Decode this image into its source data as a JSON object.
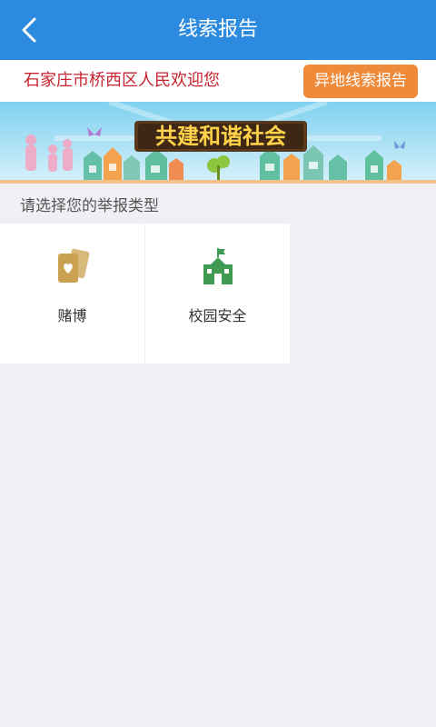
{
  "header": {
    "title": "线索报告"
  },
  "welcome": {
    "text": "石家庄市桥西区人民欢迎您",
    "remote_button": "异地线索报告"
  },
  "banner": {
    "slogan": "共建和谐社会"
  },
  "report": {
    "prompt": "请选择您的举报类型",
    "types": [
      {
        "label": "赌博",
        "icon": "cards-icon"
      },
      {
        "label": "校园安全",
        "icon": "school-icon"
      }
    ]
  },
  "colors": {
    "header_bg": "#2c8bdf",
    "welcome_text": "#c7222e",
    "button_bg": "#ef8a3a",
    "gamble_icon": "#c9a150",
    "school_icon": "#3f9b52"
  }
}
